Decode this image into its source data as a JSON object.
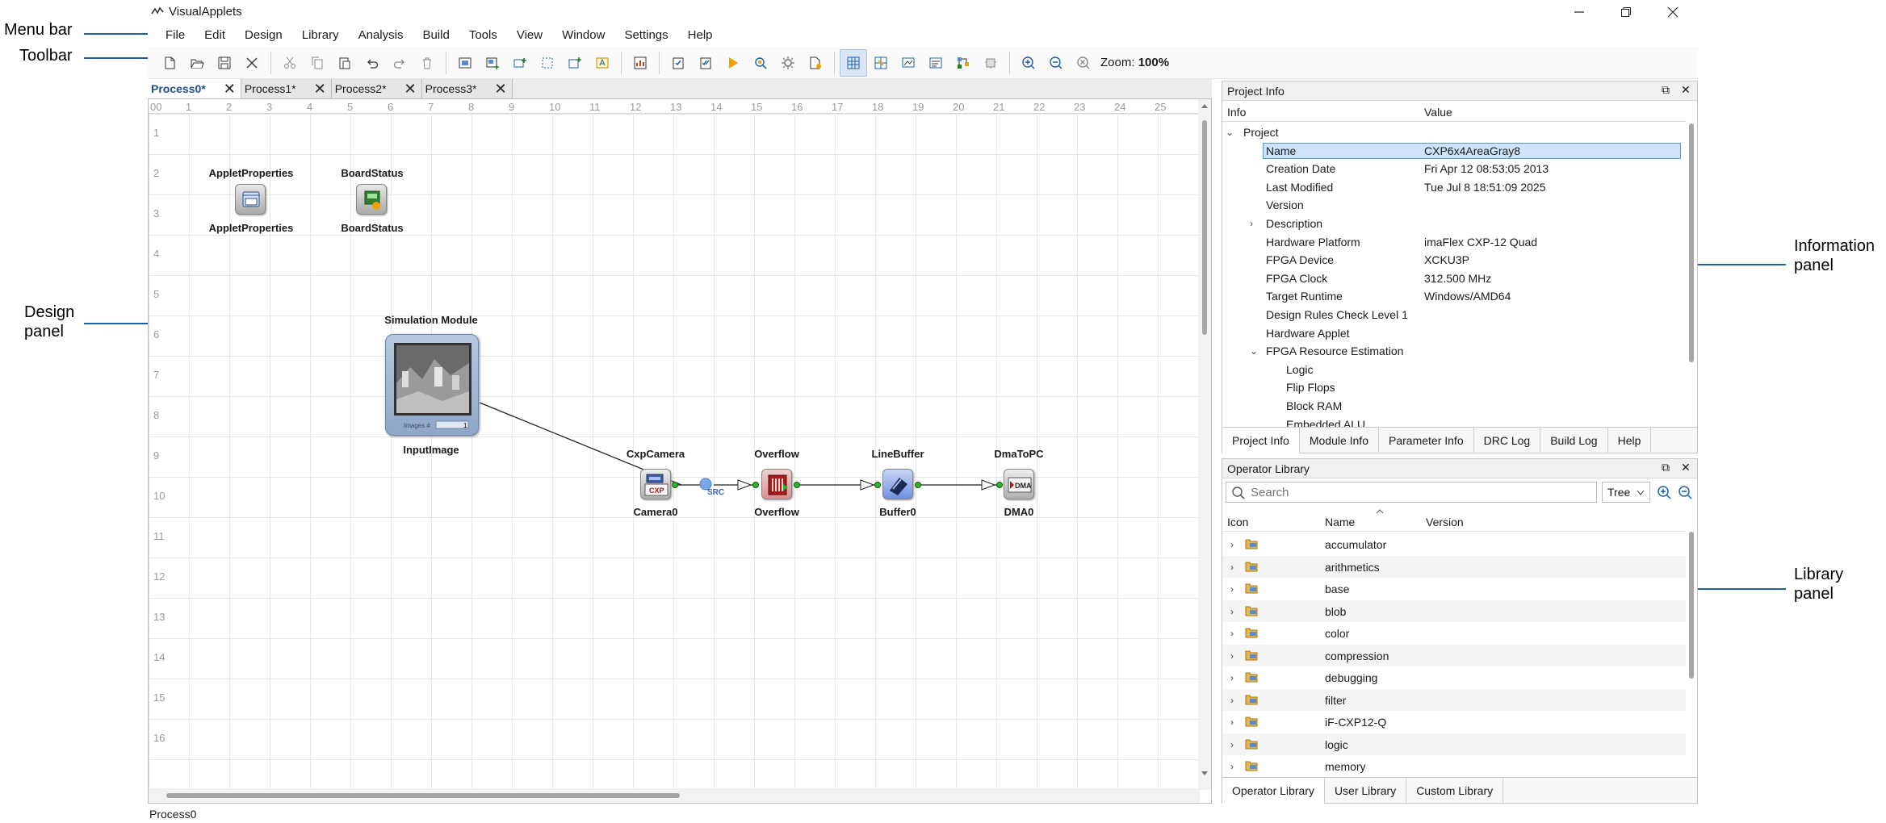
{
  "annotations": {
    "menu_bar": "Menu bar",
    "toolbar": "Toolbar",
    "design_panel_1": "Design",
    "design_panel_2": "panel",
    "info_panel_1": "Information",
    "info_panel_2": "panel",
    "library_panel_1": "Library",
    "library_panel_2": "panel"
  },
  "window": {
    "title": "VisualApplets"
  },
  "menu": [
    "File",
    "Edit",
    "Design",
    "Library",
    "Analysis",
    "Build",
    "Tools",
    "View",
    "Window",
    "Settings",
    "Help"
  ],
  "toolbar": {
    "zoom_label": "Zoom:",
    "zoom_value": "100%"
  },
  "tabs": [
    "Process0*",
    "Process1*",
    "Process2*",
    "Process3*"
  ],
  "design": {
    "ruler_x": [
      "00",
      "1",
      "2",
      "3",
      "4",
      "5",
      "6",
      "7",
      "8",
      "9",
      "10",
      "11",
      "12",
      "13",
      "14",
      "15",
      "16",
      "17",
      "18",
      "19",
      "20",
      "21",
      "22",
      "23",
      "24",
      "25"
    ],
    "ruler_y": [
      "1",
      "2",
      "3",
      "4",
      "5",
      "6",
      "7",
      "8",
      "9",
      "10",
      "11",
      "12",
      "13",
      "14",
      "15",
      "16"
    ],
    "operators": {
      "applet_top": "AppletProperties",
      "applet_bottom": "AppletProperties",
      "board_top": "BoardStatus",
      "board_bottom": "BoardStatus",
      "sim_top": "Simulation Module",
      "sim_bottom": "InputImage",
      "sim_caption": "Images #",
      "sim_count": "1",
      "cam_top": "CxpCamera",
      "cam_bottom": "Camera0",
      "cam_badge": "CXP",
      "src_label": "SRC",
      "ovf_top": "Overflow",
      "ovf_bottom": "Overflow",
      "lb_top": "LineBuffer",
      "lb_bottom": "Buffer0",
      "dma_top": "DmaToPC",
      "dma_bottom": "DMA0",
      "dma_badge": "DMA"
    }
  },
  "project_info": {
    "header": "Project Info",
    "col_info": "Info",
    "col_value": "Value",
    "rows": [
      {
        "k": "Project",
        "v": ""
      },
      {
        "k": "Name",
        "v": "CXP6x4AreaGray8"
      },
      {
        "k": "Creation Date",
        "v": "Fri Apr 12 08:53:05 2013"
      },
      {
        "k": "Last Modified",
        "v": "Tue Jul 8 18:51:09 2025"
      },
      {
        "k": "Version",
        "v": ""
      },
      {
        "k": "Description",
        "v": ""
      },
      {
        "k": "Hardware Platform",
        "v": "imaFlex CXP-12 Quad"
      },
      {
        "k": "FPGA Device",
        "v": "XCKU3P"
      },
      {
        "k": "FPGA Clock",
        "v": "312.500 MHz"
      },
      {
        "k": "Target Runtime",
        "v": "Windows/AMD64"
      },
      {
        "k": "Design Rules Check Level 1",
        "v": ""
      },
      {
        "k": "Hardware Applet",
        "v": ""
      },
      {
        "k": "FPGA Resource Estimation",
        "v": ""
      },
      {
        "k": "Logic",
        "v": ""
      },
      {
        "k": "Flip Flops",
        "v": ""
      },
      {
        "k": "Block RAM",
        "v": ""
      },
      {
        "k": "Embedded ALU",
        "v": ""
      }
    ],
    "tabs": [
      "Project Info",
      "Module Info",
      "Parameter Info",
      "DRC Log",
      "Build Log",
      "Help"
    ]
  },
  "operator_library": {
    "header": "Operator Library",
    "search_placeholder": "Search",
    "view_mode": "Tree",
    "col_icon": "Icon",
    "col_name": "Name",
    "col_version": "Version",
    "items": [
      "accumulator",
      "arithmetics",
      "base",
      "blob",
      "color",
      "compression",
      "debugging",
      "filter",
      "iF-CXP12-Q",
      "logic",
      "memory"
    ],
    "tabs": [
      "Operator Library",
      "User Library",
      "Custom Library"
    ]
  },
  "status": {
    "text": "Process0"
  }
}
